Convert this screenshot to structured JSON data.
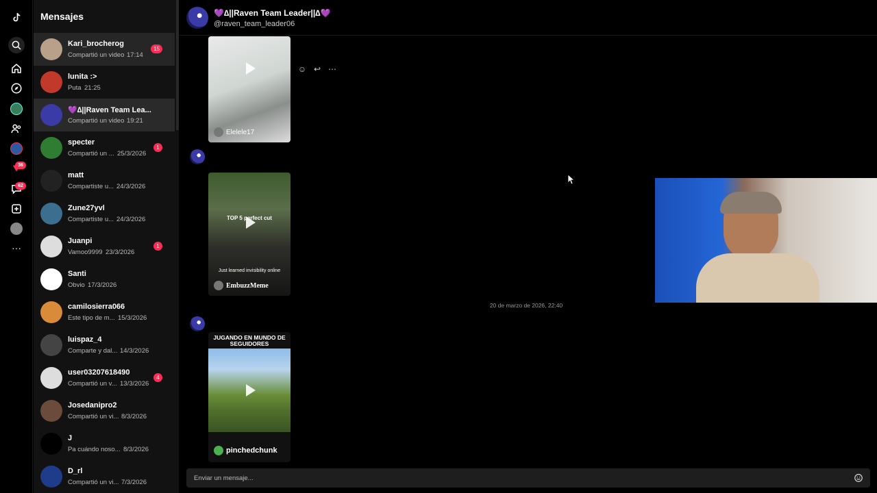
{
  "sidebar_title": "Mensajes",
  "rail": {
    "badges": [
      "36",
      "62"
    ]
  },
  "conversations": [
    {
      "name": "Kari_brocherog",
      "preview": "Compartió un video",
      "time": "17:14",
      "badge": "15"
    },
    {
      "name": "lunita :>",
      "preview": "Puta",
      "time": "21:25",
      "badge": ""
    },
    {
      "name": "💜∆||Raven Team Lea...",
      "preview": "Compartió un video",
      "time": "19:21",
      "badge": ""
    },
    {
      "name": "specter",
      "preview": "Compartió un ...",
      "time": "25/3/2026",
      "badge": "1"
    },
    {
      "name": "matt",
      "preview": "Compartiste u...",
      "time": "24/3/2026",
      "badge": ""
    },
    {
      "name": "Zune27yvl",
      "preview": "Compartiste u...",
      "time": "24/3/2026",
      "badge": ""
    },
    {
      "name": "Juanpi",
      "preview": "Vamoo9999",
      "time": "23/3/2026",
      "badge": "1"
    },
    {
      "name": "Santi",
      "preview": "Obvio",
      "time": "17/3/2026",
      "badge": ""
    },
    {
      "name": "camilosierra066",
      "preview": "Este tipo de m...",
      "time": "15/3/2026",
      "badge": ""
    },
    {
      "name": "luispaz_4",
      "preview": "Comparte y dal...",
      "time": "14/3/2026",
      "badge": ""
    },
    {
      "name": "user03207618490",
      "preview": "Compartió un v...",
      "time": "13/3/2026",
      "badge": "4"
    },
    {
      "name": "Josedanipro2",
      "preview": "Compartió un vi...",
      "time": "8/3/2026",
      "badge": ""
    },
    {
      "name": "J",
      "preview": "Pa cuándo noso...",
      "time": "8/3/2026",
      "badge": ""
    },
    {
      "name": "D_rl",
      "preview": "Compartió un vi...",
      "time": "7/3/2026",
      "badge": ""
    }
  ],
  "chat": {
    "name": "💜∆||Raven Team Leader||∆💜",
    "handle": "@raven_team_leader06",
    "date_separator": "20 de marzo de 2026, 22:40",
    "videos": [
      {
        "author": "Elelele17",
        "caption": ""
      },
      {
        "author": "EmbuzzMeme",
        "caption": "Just learned invisibility online",
        "overlay": "TOP 5 perfect cut"
      },
      {
        "author": "pinchedchunk",
        "caption": "JUGANDO EN MUNDO DE SEGUIDORES"
      }
    ],
    "composer_placeholder": "Enviar un mensaje..."
  },
  "colors": {
    "badge": "#fe2c55",
    "active_row": "#2a2a2a",
    "list_bg": "#121212"
  }
}
